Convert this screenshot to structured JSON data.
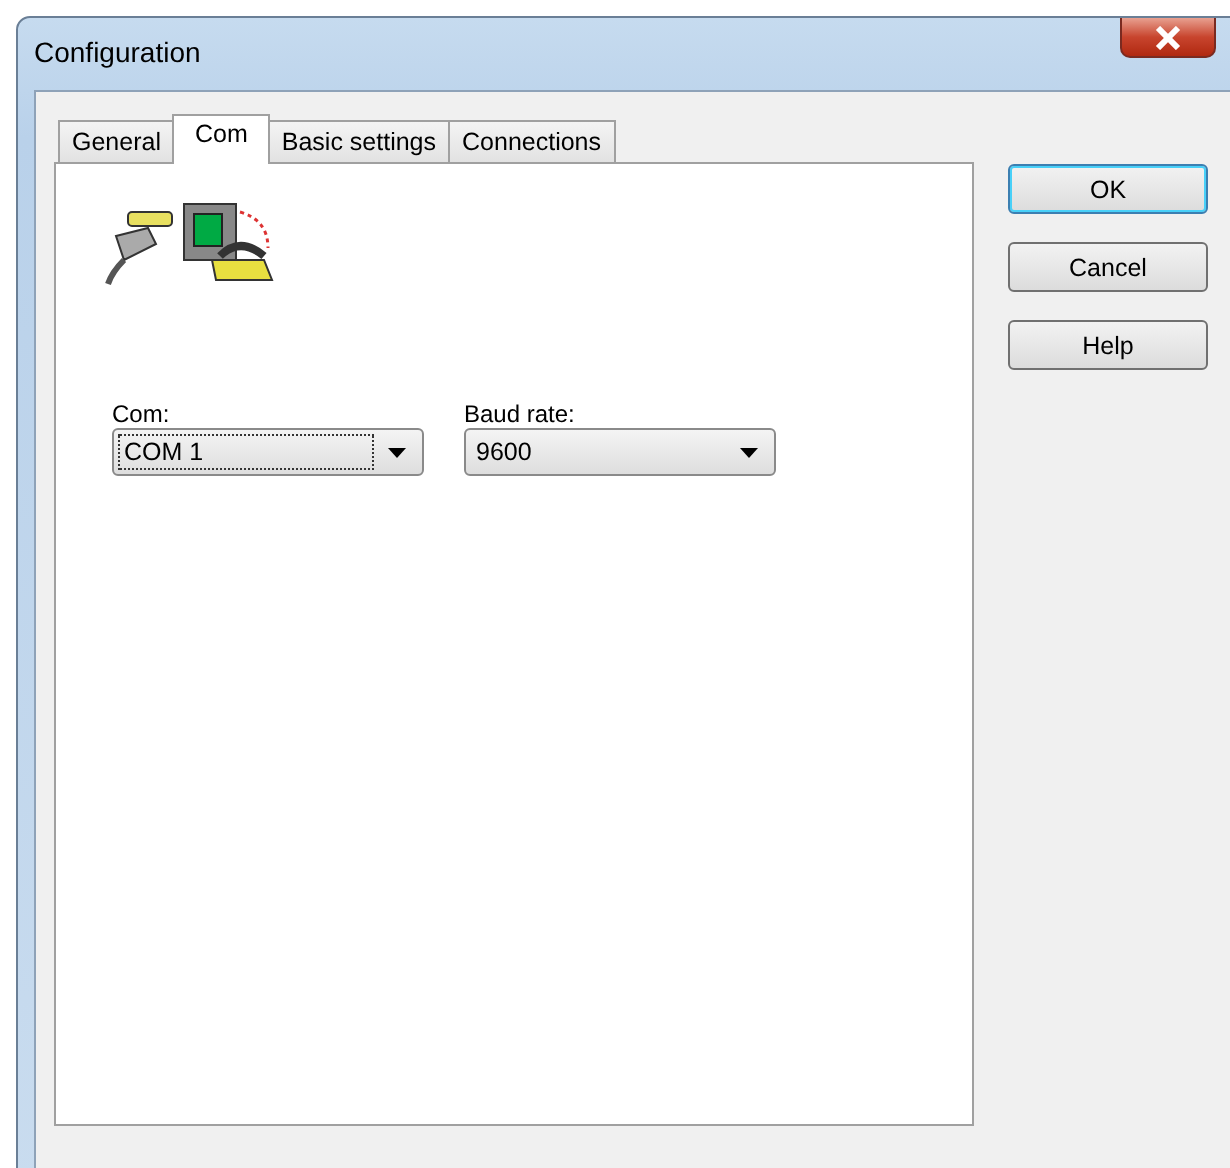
{
  "window": {
    "title": "Configuration"
  },
  "tabs": [
    {
      "label": "General",
      "selected": false
    },
    {
      "label": "Com",
      "selected": true
    },
    {
      "label": "Basic settings",
      "selected": false
    },
    {
      "label": "Connections",
      "selected": false
    }
  ],
  "fields": [
    {
      "label": "Com:",
      "value": "COM 1",
      "focused": true
    },
    {
      "label": "Baud rate:",
      "value": "9600",
      "focused": false
    }
  ],
  "buttons": [
    {
      "label": "OK",
      "default": true
    },
    {
      "label": "Cancel",
      "default": false
    },
    {
      "label": "Help",
      "default": false
    }
  ]
}
